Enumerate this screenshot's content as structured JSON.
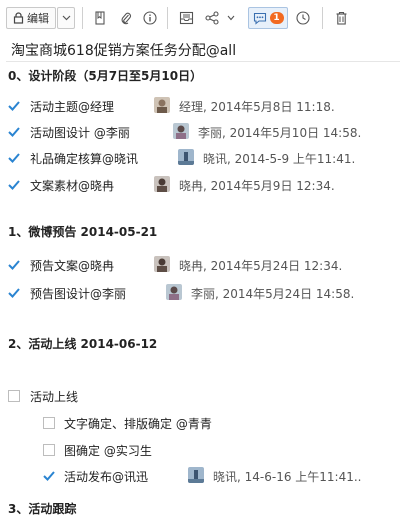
{
  "toolbar": {
    "edit_label": "编辑",
    "comment_badge": "1",
    "accent_color": "#f26a21"
  },
  "document": {
    "title": "淘宝商城618促销方案任务分配@all"
  },
  "sections": [
    {
      "heading": "0、设计阶段（5月7日至5月10日）",
      "tasks": [
        {
          "label": "活动主题@经理",
          "checked": true,
          "meta": "经理, 2014年5月8日 11:18."
        },
        {
          "label": "活动图设计 @李丽",
          "checked": true,
          "meta": "李丽, 2014年5月10日 14:58."
        },
        {
          "label": "礼品确定核算@晓讯",
          "checked": true,
          "meta": "晓讯, 2014-5-9 上午11:41."
        },
        {
          "label": "文案素材@晓冉",
          "checked": true,
          "meta": "晓冉, 2014年5月9日 12:34."
        }
      ]
    },
    {
      "heading": "1、微博预告 2014-05-21",
      "tasks": [
        {
          "label": "预告文案@晓冉",
          "checked": true,
          "meta": "晓冉, 2014年5月24日 12:34."
        },
        {
          "label": "预告图设计@李丽",
          "checked": true,
          "meta": "李丽, 2014年5月24日 14:58."
        }
      ]
    },
    {
      "heading": "2、活动上线  2014-06-12",
      "tasks": [
        {
          "label": "活动上线",
          "checked": false,
          "meta": ""
        },
        {
          "label": "文字确定、排版确定 @青青",
          "checked": false,
          "meta": ""
        },
        {
          "label": "图确定  @实习生",
          "checked": false,
          "meta": ""
        },
        {
          "label": "活动发布@讯迅",
          "checked": true,
          "meta": "晓讯, 14-6-16 上午11:41.."
        }
      ]
    },
    {
      "heading": "3、活动跟踪",
      "tasks": []
    }
  ]
}
